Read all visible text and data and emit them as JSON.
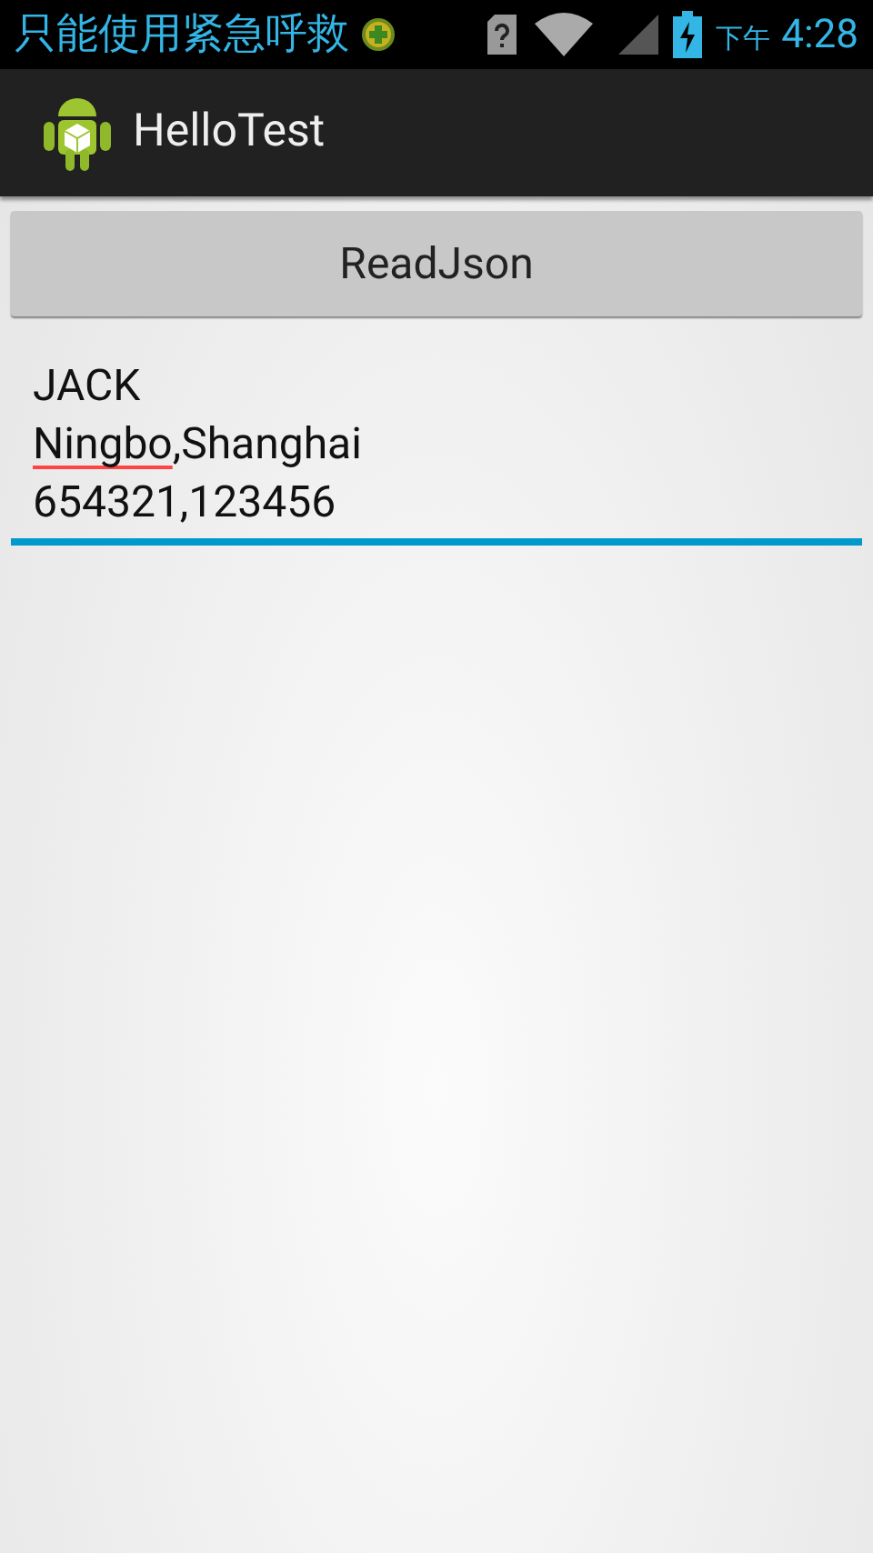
{
  "status_bar": {
    "notification": "只能使用紧急呼救",
    "time_period": "下午",
    "time": "4:28",
    "charging": true
  },
  "action_bar": {
    "title": "HelloTest"
  },
  "button": {
    "label": "ReadJson"
  },
  "text_field": {
    "focused": true,
    "lines": [
      [
        {
          "text": "JACK",
          "misspelled": false
        }
      ],
      [
        {
          "text": "Ningbo",
          "misspelled": true
        },
        {
          "text": ",Shanghai",
          "misspelled": false
        }
      ],
      [
        {
          "text": "654321,123456",
          "misspelled": false
        }
      ]
    ]
  }
}
